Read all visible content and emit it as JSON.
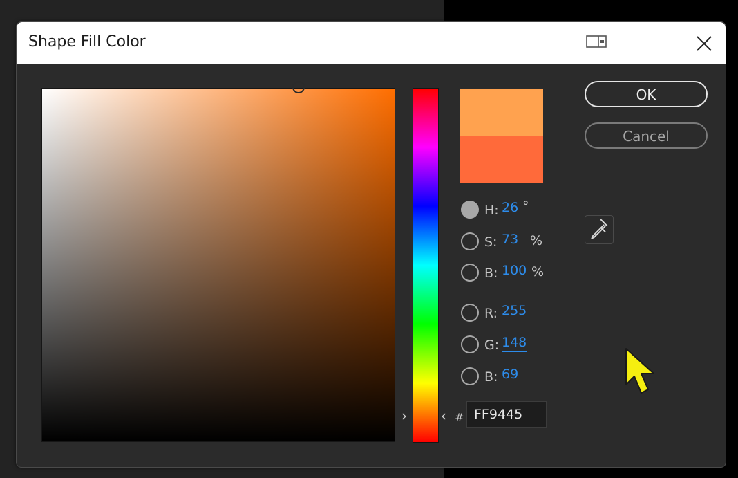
{
  "dialog": {
    "title": "Shape Fill Color",
    "ok_label": "OK",
    "cancel_label": "Cancel"
  },
  "picker": {
    "hue": {
      "label": "H:",
      "value": "26",
      "unit": "°",
      "checked": true
    },
    "saturation": {
      "label": "S:",
      "value": "73",
      "unit": "%"
    },
    "brightness": {
      "label": "B:",
      "value": "100",
      "unit": "%"
    },
    "red": {
      "label": "R:",
      "value": "255"
    },
    "green": {
      "label": "G:",
      "value": "148"
    },
    "blue": {
      "label": "B:",
      "value": "69"
    },
    "hex_prefix": "#",
    "hex": "FF9445"
  },
  "swatches": {
    "new_color": "#ffa24f",
    "old_color": "#ff6a3a"
  },
  "colors": {
    "accent_value": "#2d8ceb",
    "dialog_bg": "#2b2b2b",
    "title_bg": "#ffffff"
  },
  "icons": {
    "title_extra": "window-layout-icon",
    "close": "close-icon",
    "eyedropper": "eyedropper-icon",
    "cursor": "mouse-pointer-icon"
  }
}
